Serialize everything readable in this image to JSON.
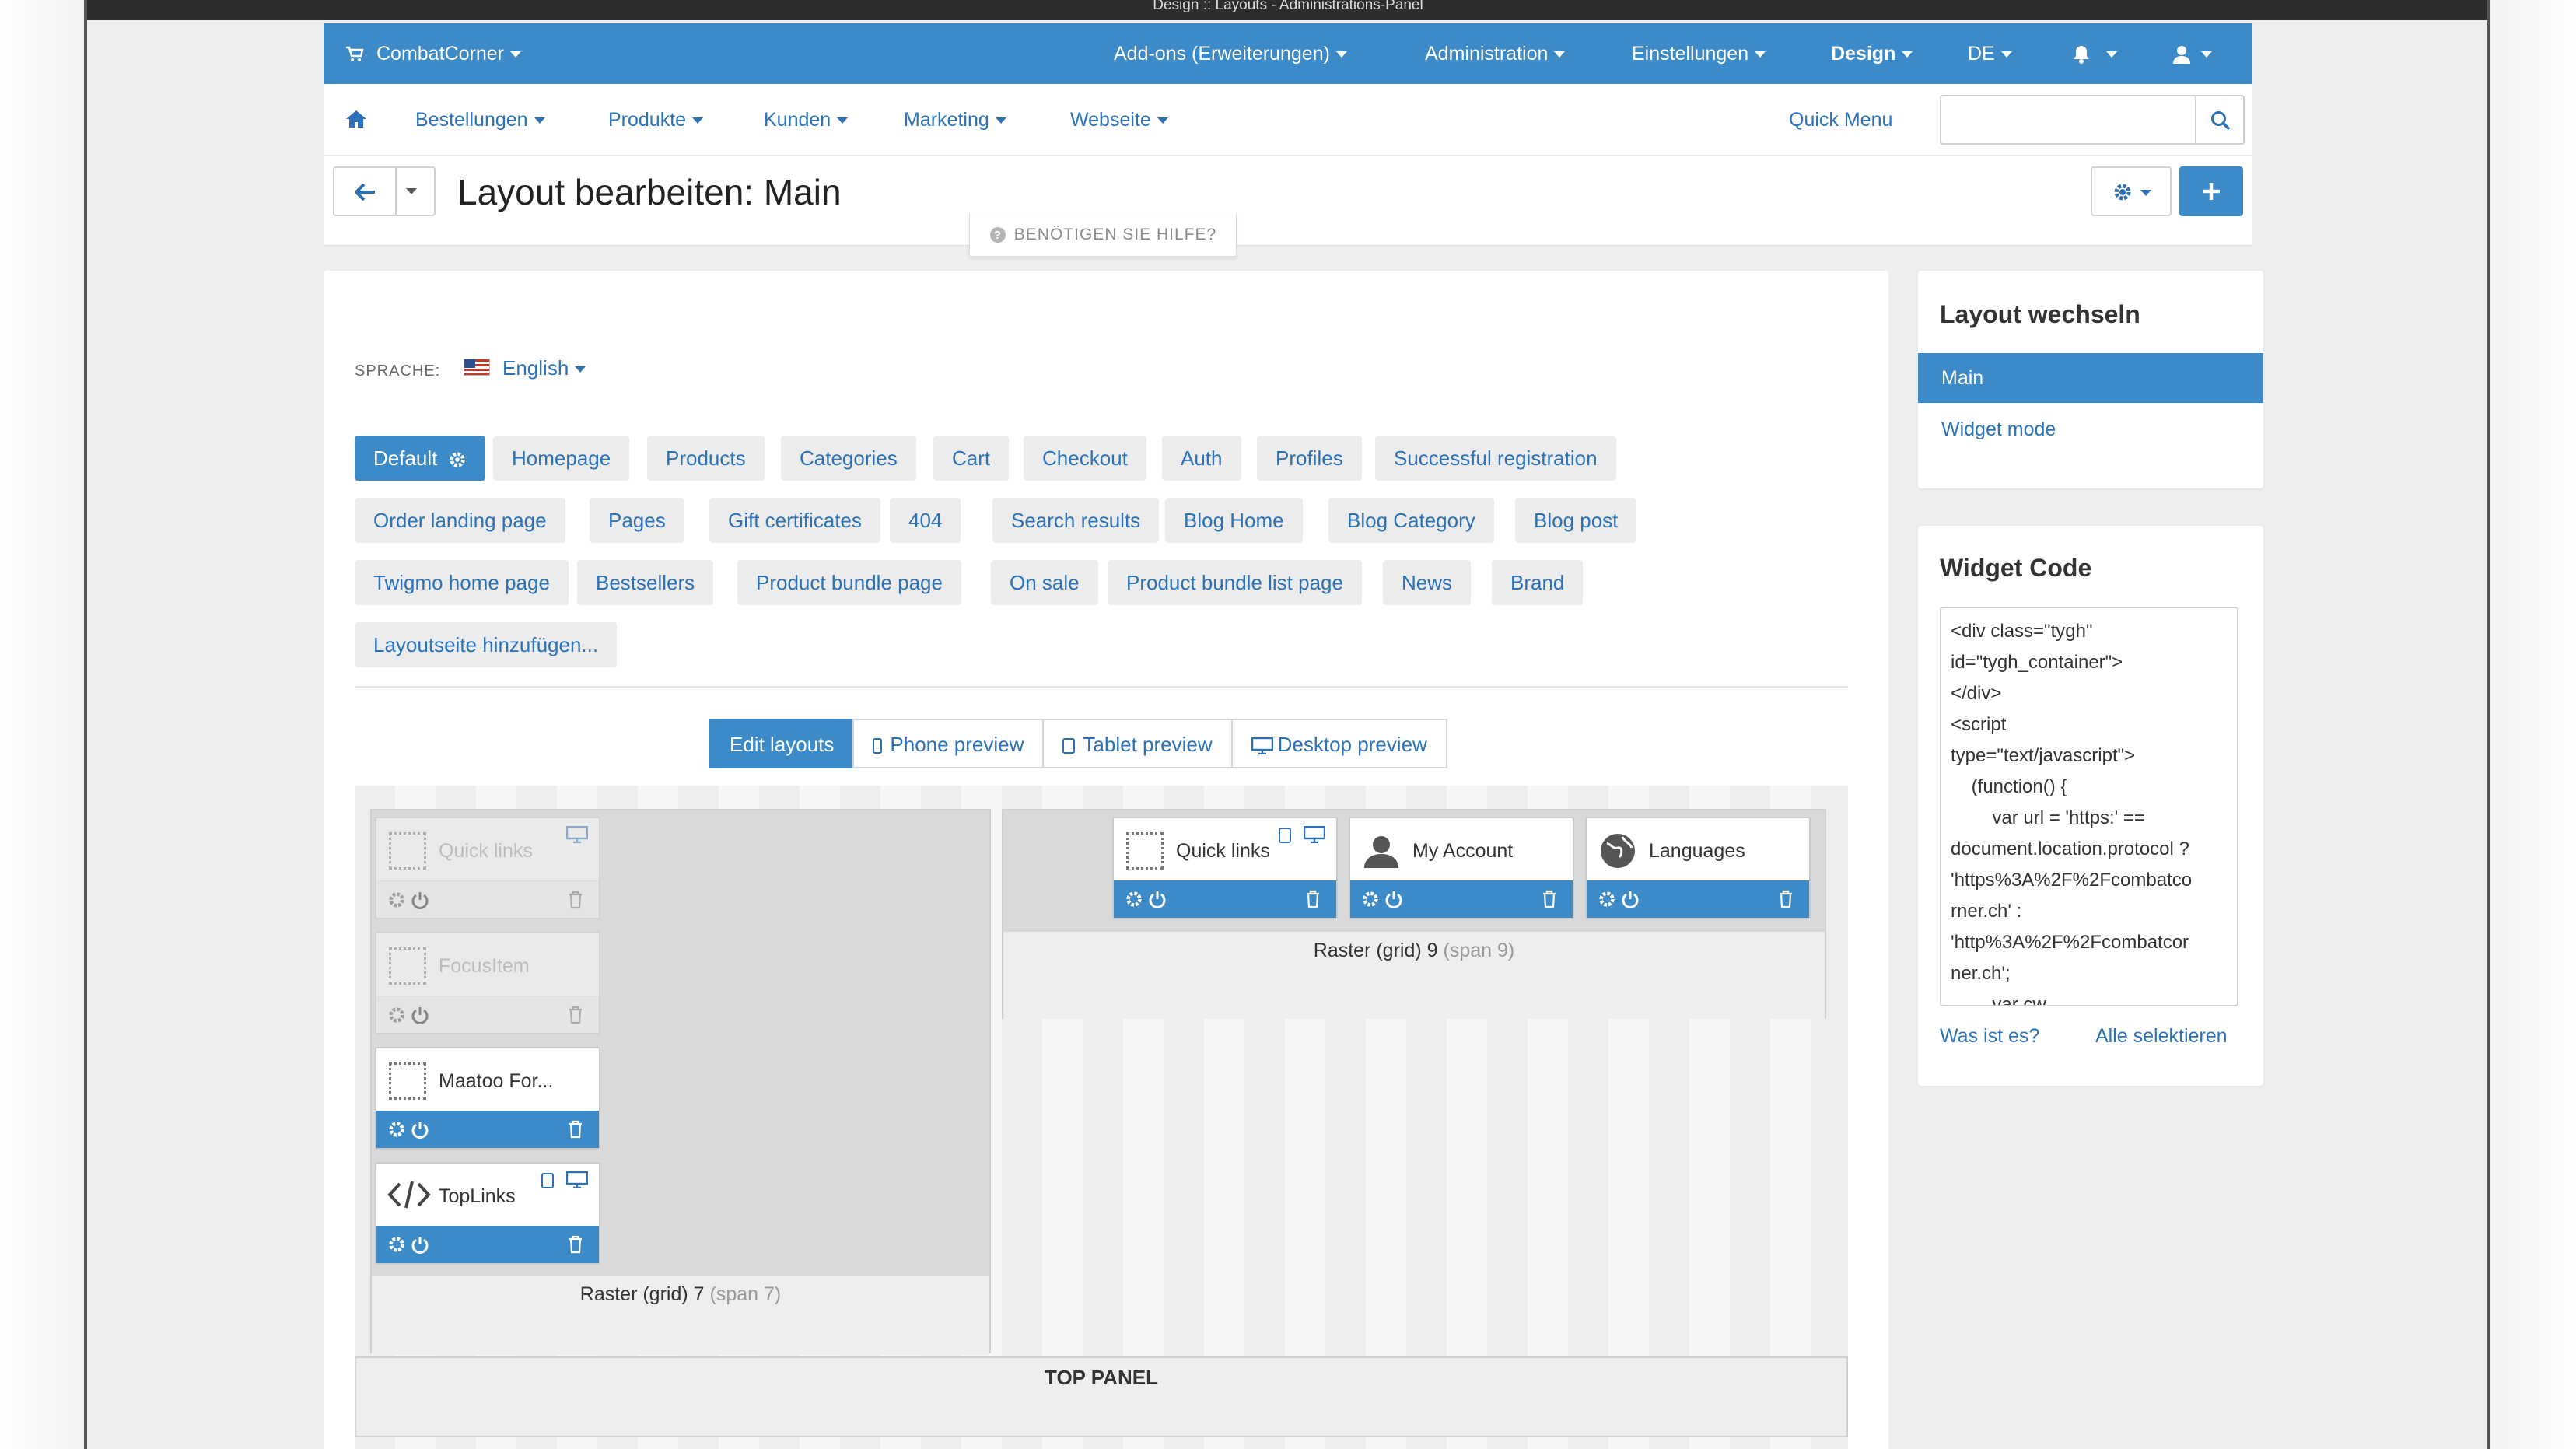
{
  "window_title": "Design :: Layouts - Administrations-Panel",
  "topbar": {
    "brand": "CombatCorner",
    "items": [
      "Add-ons (Erweiterungen)",
      "Administration",
      "Einstellungen",
      "Design",
      "DE"
    ]
  },
  "nav": {
    "items": [
      "Bestellungen",
      "Produkte",
      "Kunden",
      "Marketing",
      "Webseite"
    ],
    "quick_menu": "Quick Menu",
    "search_placeholder": ""
  },
  "page": {
    "title": "Layout bearbeiten: Main",
    "help": "BENÖTIGEN SIE HILFE?"
  },
  "language": {
    "label": "SPRACHE:",
    "value": "English"
  },
  "layout_pages": [
    "Default",
    "Homepage",
    "Products",
    "Categories",
    "Cart",
    "Checkout",
    "Auth",
    "Profiles",
    "Successful registration",
    "Order landing page",
    "Pages",
    "Gift certificates",
    "404",
    "Search results",
    "Blog Home",
    "Blog Category",
    "Blog post",
    "Twigmo home page",
    "Bestsellers",
    "Product bundle page",
    "On sale",
    "Product bundle list page",
    "News",
    "Brand"
  ],
  "add_layout_page": "Layoutseite hinzufügen...",
  "modes": [
    "Edit layouts",
    "Phone preview",
    "Tablet preview",
    "Desktop preview"
  ],
  "grid7": {
    "caption": "Raster (grid) 7",
    "span": "(span 7)",
    "widgets": [
      "Quick links",
      "FocusItem",
      "Maatoo For...",
      "TopLinks"
    ]
  },
  "grid9": {
    "caption": "Raster (grid) 9",
    "span": "(span 9)",
    "widgets": [
      "Quick links",
      "My Account",
      "Languages"
    ]
  },
  "top_panel": "TOP PANEL",
  "switch_layout": {
    "title": "Layout wechseln",
    "items": [
      "Main",
      "Widget mode"
    ]
  },
  "widget_code": {
    "title": "Widget Code",
    "code": "<div class=\"tygh\"\nid=\"tygh_container\">\n</div>\n<script\ntype=\"text/javascript\">\n    (function() {\n        var url = 'https:' ==\ndocument.location.protocol ?\n'https%3A%2F%2Fcombatco\nrner.ch' :\n'http%3A%2F%2Fcombatcor\nner.ch';\n        var cw",
    "what_is_it": "Was ist es?",
    "select_all": "Alle selektieren"
  },
  "colors": {
    "primary": "#3c8ac7",
    "link": "#2b72b8",
    "panel_bg": "#eeeeee"
  },
  "icons": [
    "cart-icon",
    "home-icon",
    "search-icon",
    "back-arrow-icon",
    "gear-icon",
    "plus-icon",
    "help-icon",
    "bell-icon",
    "user-icon",
    "power-icon",
    "trash-icon",
    "phone-icon",
    "tablet-icon",
    "desktop-icon",
    "code-icon",
    "avatar-icon",
    "globe-icon"
  ]
}
